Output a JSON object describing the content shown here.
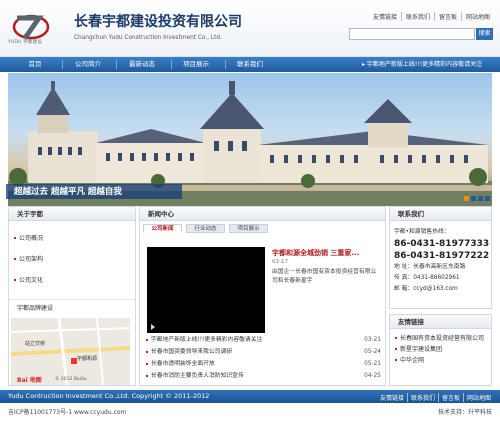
{
  "header": {
    "logo_text": "YUDU",
    "logo_subtext": "YUDU 宇都建设",
    "company_cn": "长春宇都建设投资有限公司",
    "company_en": "Changchun Yudu Construction Investment Co., Ltd.",
    "top_links": [
      "友情链接",
      "联系我们",
      "留言板",
      "网站地图"
    ],
    "search_button": "搜索"
  },
  "nav": {
    "items": [
      "首页",
      "公司简介",
      "最新动态",
      "项目展示",
      "联系我们"
    ],
    "marquee": "宇都地产新版上线!!!更多精彩内容敬请关注"
  },
  "banner": {
    "slogan": "超越过去  超越平凡  超越自我",
    "dots": 4
  },
  "about": {
    "title": "关于宇都",
    "items": [
      "公司概况",
      "公司架构",
      "公司文化"
    ]
  },
  "map": {
    "title": "宇都品牌建设",
    "labels": [
      "站立交桥",
      "宇都和源",
      "长春站"
    ],
    "copyright": "© 2012 Baidu",
    "brand": "Bai 地图"
  },
  "news": {
    "title": "新闻中心",
    "tabs": [
      "公司新闻",
      "行业动态",
      "项目展示"
    ],
    "featured": {
      "title": "宇都和源全城劲销  三重家...",
      "date": "03-17",
      "desc": "由国企－长春市国有资本投资经营有限公司和长春新星宇"
    },
    "list": [
      {
        "title": "宇都地产新版上线!!!更多精彩内容敬请关注",
        "date": "03-21"
      },
      {
        "title": "长春市国资委领导来我公司调研",
        "date": "05-24"
      },
      {
        "title": "长春市透明装饰全面开放",
        "date": "05-21"
      },
      {
        "title": "长春市消防主要负责人消防知识宣传",
        "date": "04-25"
      }
    ]
  },
  "contact": {
    "title": "联系我们",
    "hotline_label": "宇都•和源销售热线：",
    "phones": [
      "86-0431-81977333",
      "86-0431-81977222"
    ],
    "address": "地  址：长春市高新区东南路",
    "fax": "传  真：0431-88602961",
    "email": "邮  箱：ccyd@163.com"
  },
  "links": {
    "title": "友情链接",
    "items": [
      "长春国有资本投资经营有限公司",
      "新星宇建设集团",
      "中华企网"
    ]
  },
  "footer": {
    "copyright": "Yudu Contruction Investment Co.,Ltd. Copyright © 2011-2012",
    "links": [
      "友情链接",
      "联系我们",
      "留言板",
      "网站地图"
    ],
    "icp": "吉ICP备11001773号-1 www.ccyudu.com",
    "tech": "技术支持：升平科技"
  }
}
